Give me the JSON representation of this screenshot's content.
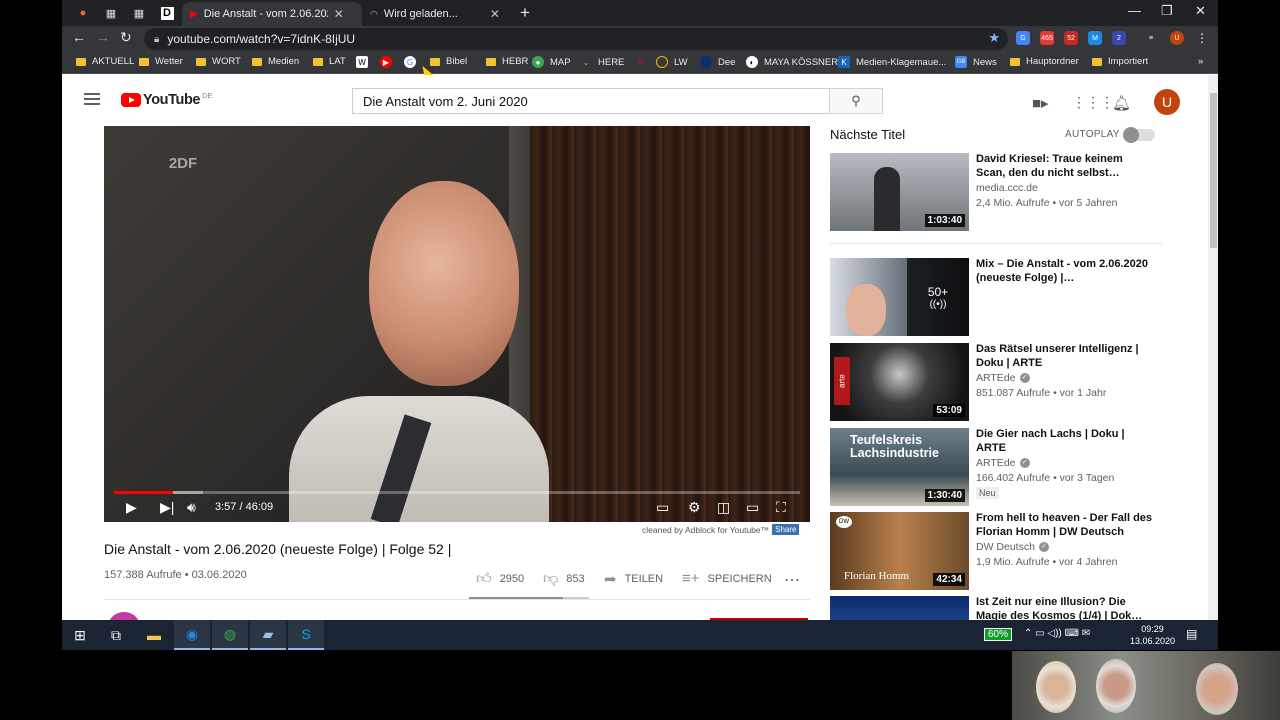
{
  "browser": {
    "tabs": [
      {
        "title": "Die Anstalt - vom 2.06.2020 (neu",
        "active": true
      },
      {
        "title": "Wird geladen...",
        "active": false
      }
    ],
    "url": "youtube.com/watch?v=7idnK-8IjUU",
    "bookmarks": [
      "AKTUELL",
      "Wetter",
      "WORT",
      "Medien",
      "LAT",
      "Bibel",
      "HEBR",
      "MAP",
      "HERE",
      "LW",
      "Dee",
      "MAYA KÖSSNER",
      "Medien-Klagemaue...",
      "News",
      "Hauptordner",
      "Importiert"
    ],
    "pinned_tab_d": "D",
    "ext_badges": [
      "465",
      "52"
    ]
  },
  "youtube": {
    "region": "DE",
    "logo_text": "YouTube",
    "search_query": "Die Anstalt vom 2. Juni 2020",
    "avatar_letter": "U",
    "player": {
      "time": "3:57 / 46:09",
      "progress": 0.086,
      "buffered": 0.13,
      "watermark": "2DF"
    },
    "adblock_note": "cleaned by Adblock for Youtube™",
    "adblock_share": "Share",
    "video_title": "Die Anstalt - vom 2.06.2020 (neueste Folge) | Folge 52 |",
    "video_meta": "157.388 Aufrufe • 03.06.2020",
    "likes": "2950",
    "dislikes": "853",
    "like_ratio": 0.78,
    "share_label": "TEILEN",
    "save_label": "SPEICHERN",
    "up_next_header": "Nächste Titel",
    "autoplay_label": "AUTOPLAY",
    "recommendations": [
      {
        "title": "David Kriesel: Traue keinem Scan, den du nicht selbst…",
        "channel": "media.ccc.de",
        "views": "2,4 Mio. Aufrufe • vor 5 Jahren",
        "duration": "1:03:40",
        "verified": false
      },
      {
        "title": "Mix – Die Anstalt - vom 2.06.2020 (neueste Folge) |…",
        "channel": "",
        "views": "",
        "duration": "",
        "mix_count": "50+",
        "verified": false
      },
      {
        "title": "Das Rätsel unserer Intelligenz | Doku | ARTE",
        "channel": "ARTEde",
        "views": "851.087 Aufrufe • vor 1 Jahr",
        "duration": "53:09",
        "verified": true
      },
      {
        "title": "Die Gier nach Lachs | Doku | ARTE",
        "channel": "ARTEde",
        "views": "166.402 Aufrufe • vor 3 Tagen",
        "duration": "1:30:40",
        "verified": true,
        "badge": "Neu",
        "thumb_text": "Teufelskreis Lachsindustrie"
      },
      {
        "title": "From hell to heaven - Der Fall des Florian Homm | DW Deutsch",
        "channel": "DW Deutsch",
        "views": "1,9 Mio. Aufrufe • vor 4 Jahren",
        "duration": "42:34",
        "verified": true,
        "thumb_text": "Florian Homm"
      },
      {
        "title": "Ist Zeit nur eine Illusion? Die Magie des Kosmos (1/4) | Dok…",
        "channel": "",
        "views": "",
        "duration": "",
        "verified": false
      }
    ]
  },
  "taskbar": {
    "battery": "60%",
    "time": "09:29",
    "date": "13.06.2020"
  },
  "colors": {
    "yt_red": "#ff0000",
    "chrome_dark": "#202124",
    "taskbar": "#1b2433",
    "avatar": "#c1440e"
  }
}
